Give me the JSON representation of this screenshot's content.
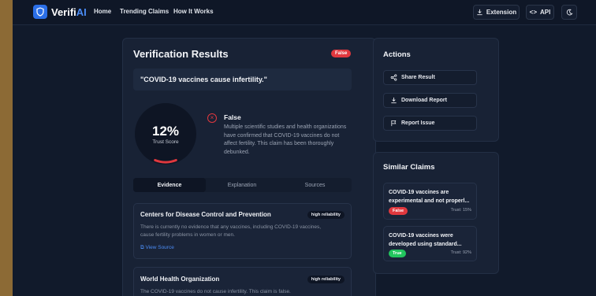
{
  "nav": {
    "brand_main": "Verifi",
    "brand_accent": "AI",
    "links": [
      "Home",
      "Trending Claims",
      "How It Works"
    ],
    "extension_label": "Extension",
    "api_label": "API"
  },
  "results": {
    "title": "Verification Results",
    "badge": "False",
    "claim": "\"COVID-19 vaccines cause infertility.\"",
    "score": "12%",
    "score_label": "Trust Score",
    "score_fraction": 0.12,
    "verdict": "False",
    "verdict_text": "Multiple scientific studies and health organizations have confirmed that COVID-19 vaccines do not affect fertility. This claim has been thoroughly debunked."
  },
  "tabs": [
    "Evidence",
    "Explanation",
    "Sources"
  ],
  "evidence": [
    {
      "title": "Centers for Disease Control and Prevention",
      "reliability": "high reliability",
      "text": "There is currently no evidence that any vaccines, including COVID-19 vaccines, cause fertility problems in women or men.",
      "link": "View Source"
    },
    {
      "title": "World Health Organization",
      "reliability": "high reliability",
      "text": "The COVID-19 vaccines do not cause infertility. This claim is false."
    }
  ],
  "actions": {
    "title": "Actions",
    "share": "Share Result",
    "download": "Download Report",
    "report": "Report Issue"
  },
  "similar": {
    "title": "Similar Claims",
    "items": [
      {
        "text": "COVID-19 vaccines are experimental and not properl...",
        "status": "False",
        "trust": "Trust: 15%"
      },
      {
        "text": "COVID-19 vaccines were developed using standard...",
        "status": "True",
        "trust": "Trust: 92%"
      }
    ]
  },
  "colors": {
    "accent": "#2b6fe8",
    "false": "#e0383e",
    "true": "#22c55e"
  }
}
